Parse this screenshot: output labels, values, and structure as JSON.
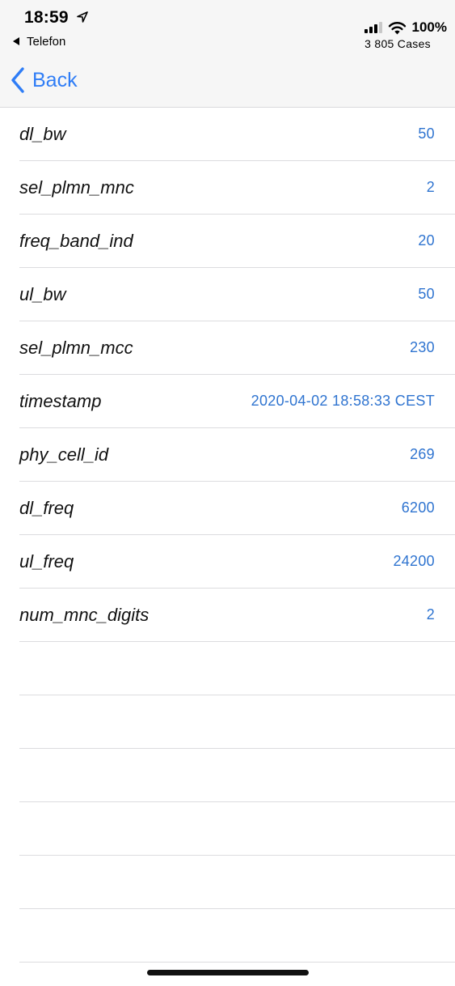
{
  "status_bar": {
    "time": "18:59",
    "back_app_label": "Telefon",
    "battery_percent": "100%",
    "subtitle": "3 805 Cases"
  },
  "nav": {
    "back_label": "Back",
    "accent_color": "#2f7df6"
  },
  "rows": [
    {
      "key": "dl_bw",
      "value": "50"
    },
    {
      "key": "sel_plmn_mnc",
      "value": "2"
    },
    {
      "key": "freq_band_ind",
      "value": "20"
    },
    {
      "key": "ul_bw",
      "value": "50"
    },
    {
      "key": "sel_plmn_mcc",
      "value": "230"
    },
    {
      "key": "timestamp",
      "value": "2020-04-02 18:58:33 CEST"
    },
    {
      "key": "phy_cell_id",
      "value": "269"
    },
    {
      "key": "dl_freq",
      "value": "6200"
    },
    {
      "key": "ul_freq",
      "value": "24200"
    },
    {
      "key": "num_mnc_digits",
      "value": "2"
    }
  ],
  "icons": {
    "location": "location-arrow-icon",
    "signal": "cellular-signal-icon",
    "wifi": "wifi-icon",
    "back": "chevron-left-icon"
  }
}
